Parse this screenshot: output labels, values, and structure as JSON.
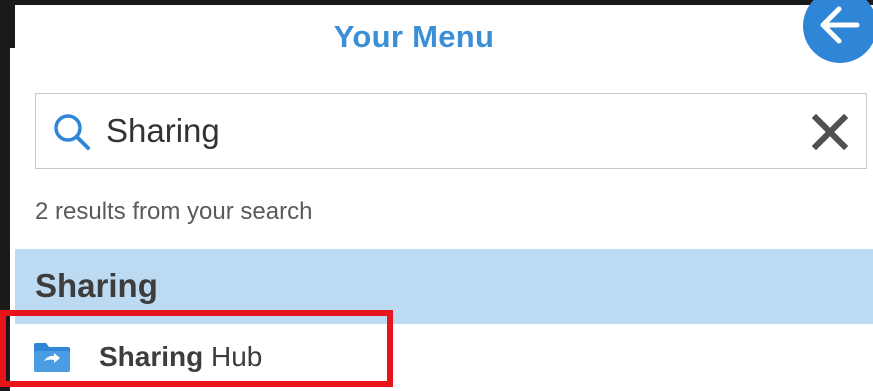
{
  "header": {
    "title": "Your Menu",
    "back_icon": "arrow-left-icon"
  },
  "search": {
    "value": "Sharing",
    "placeholder": "",
    "search_icon": "search-icon",
    "clear_icon": "close-icon"
  },
  "results": {
    "count_text": "2 results from your search",
    "category": "Sharing",
    "items": [
      {
        "icon": "folder-share-icon",
        "label_bold": "Sharing",
        "label_rest": " Hub"
      }
    ]
  },
  "colors": {
    "title_blue": "#3a8fd6",
    "back_button_blue": "#2f86d7",
    "category_bg": "#bcdaf2",
    "highlight_red": "#e8141b",
    "folder_icon_blue": "#2f86d7"
  }
}
